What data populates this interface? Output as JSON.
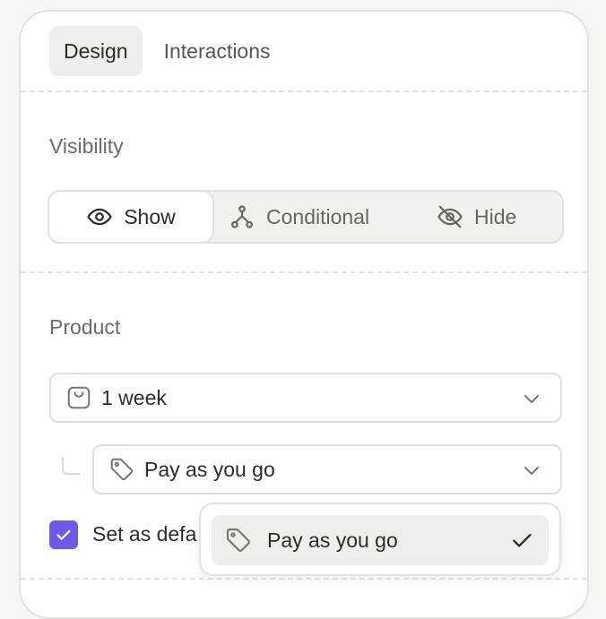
{
  "tabs": [
    {
      "label": "Design",
      "active": true
    },
    {
      "label": "Interactions",
      "active": false
    }
  ],
  "visibility": {
    "label": "Visibility",
    "options": [
      {
        "label": "Show",
        "icon": "eye-icon",
        "active": true
      },
      {
        "label": "Conditional",
        "icon": "branch-icon",
        "active": false
      },
      {
        "label": "Hide",
        "icon": "eye-off-icon",
        "active": false
      }
    ]
  },
  "product": {
    "label": "Product",
    "product_select": {
      "value": "1 week",
      "icon": "bag-icon"
    },
    "price_select": {
      "value": "Pay as you go",
      "icon": "tag-icon"
    },
    "default_checkbox": {
      "label": "Set as defa",
      "checked": true
    }
  },
  "dropdown": {
    "options": [
      {
        "label": "Pay as you go",
        "selected": true,
        "icon": "tag-icon"
      }
    ]
  },
  "colors": {
    "accent": "#6d5ae6",
    "border": "#e4e2dc",
    "surface": "#fffefc",
    "muted": "#efeeea"
  }
}
